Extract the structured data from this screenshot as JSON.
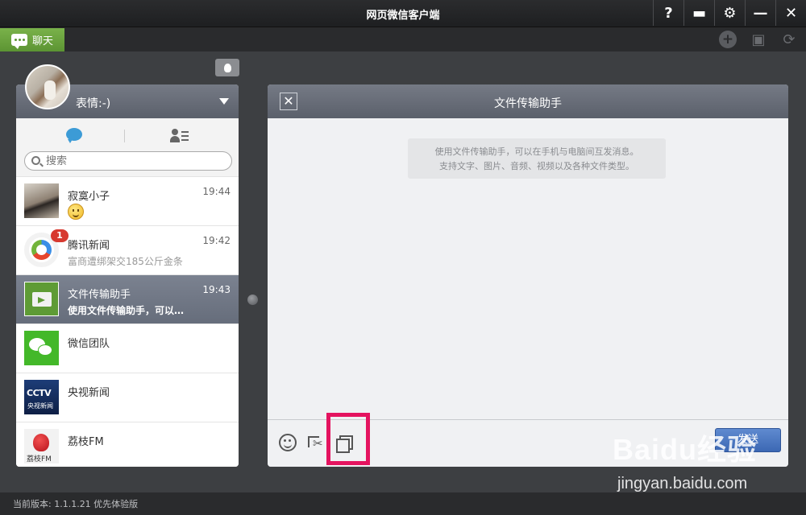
{
  "window": {
    "title": "网页微信客户端",
    "buttons": [
      {
        "name": "help-button",
        "glyph": "?"
      },
      {
        "name": "feedback-button",
        "glyph": "▬"
      },
      {
        "name": "settings-button",
        "glyph": "⚙"
      },
      {
        "name": "minimize-button",
        "glyph": "—"
      },
      {
        "name": "close-window-button",
        "glyph": "✕"
      }
    ]
  },
  "tabbar": {
    "chat_tab_label": "聊天",
    "tools": [
      {
        "name": "add-icon",
        "glyph": "+"
      },
      {
        "name": "folder-icon",
        "glyph": "▣"
      },
      {
        "name": "refresh-icon",
        "glyph": "⟳"
      }
    ]
  },
  "profile": {
    "status_label": "表情:-)"
  },
  "search": {
    "placeholder": "搜索"
  },
  "conversations": [
    {
      "name": "寂寞小子",
      "time": "19:44",
      "message": "",
      "emoji": true
    },
    {
      "name": "腾讯新闻",
      "time": "19:42",
      "message": "富商遭绑架交185公斤金条",
      "badge": "1"
    },
    {
      "name": "文件传输助手",
      "time": "19:43",
      "message": "使用文件传输助手，可以…",
      "selected": true
    },
    {
      "name": "微信团队",
      "time": "",
      "message": ""
    },
    {
      "name": "央视新闻",
      "time": "",
      "message": "",
      "logo_text": "CCTV",
      "logo_sub": "央视新闻"
    },
    {
      "name": "荔枝FM",
      "time": "",
      "message": "",
      "logo_sub": "荔枝FM"
    }
  ],
  "chat": {
    "title": "文件传输助手",
    "close_glyph": "✕",
    "notice_line1": "使用文件传输助手，可以在手机与电脑间互发消息。",
    "notice_line2": "支持文字、图片、音频、视频以及各种文件类型。",
    "send_label": "发送"
  },
  "status": {
    "version_text": "当前版本: 1.1.1.21 优先体验版"
  },
  "watermark": {
    "logo": "Baidu经验",
    "url": "jingyan.baidu.com"
  },
  "colors": {
    "accent_green": "#5c9433",
    "send_blue": "#3c68b4",
    "highlight_pink": "#e4135f",
    "badge_red": "#d7392f"
  }
}
